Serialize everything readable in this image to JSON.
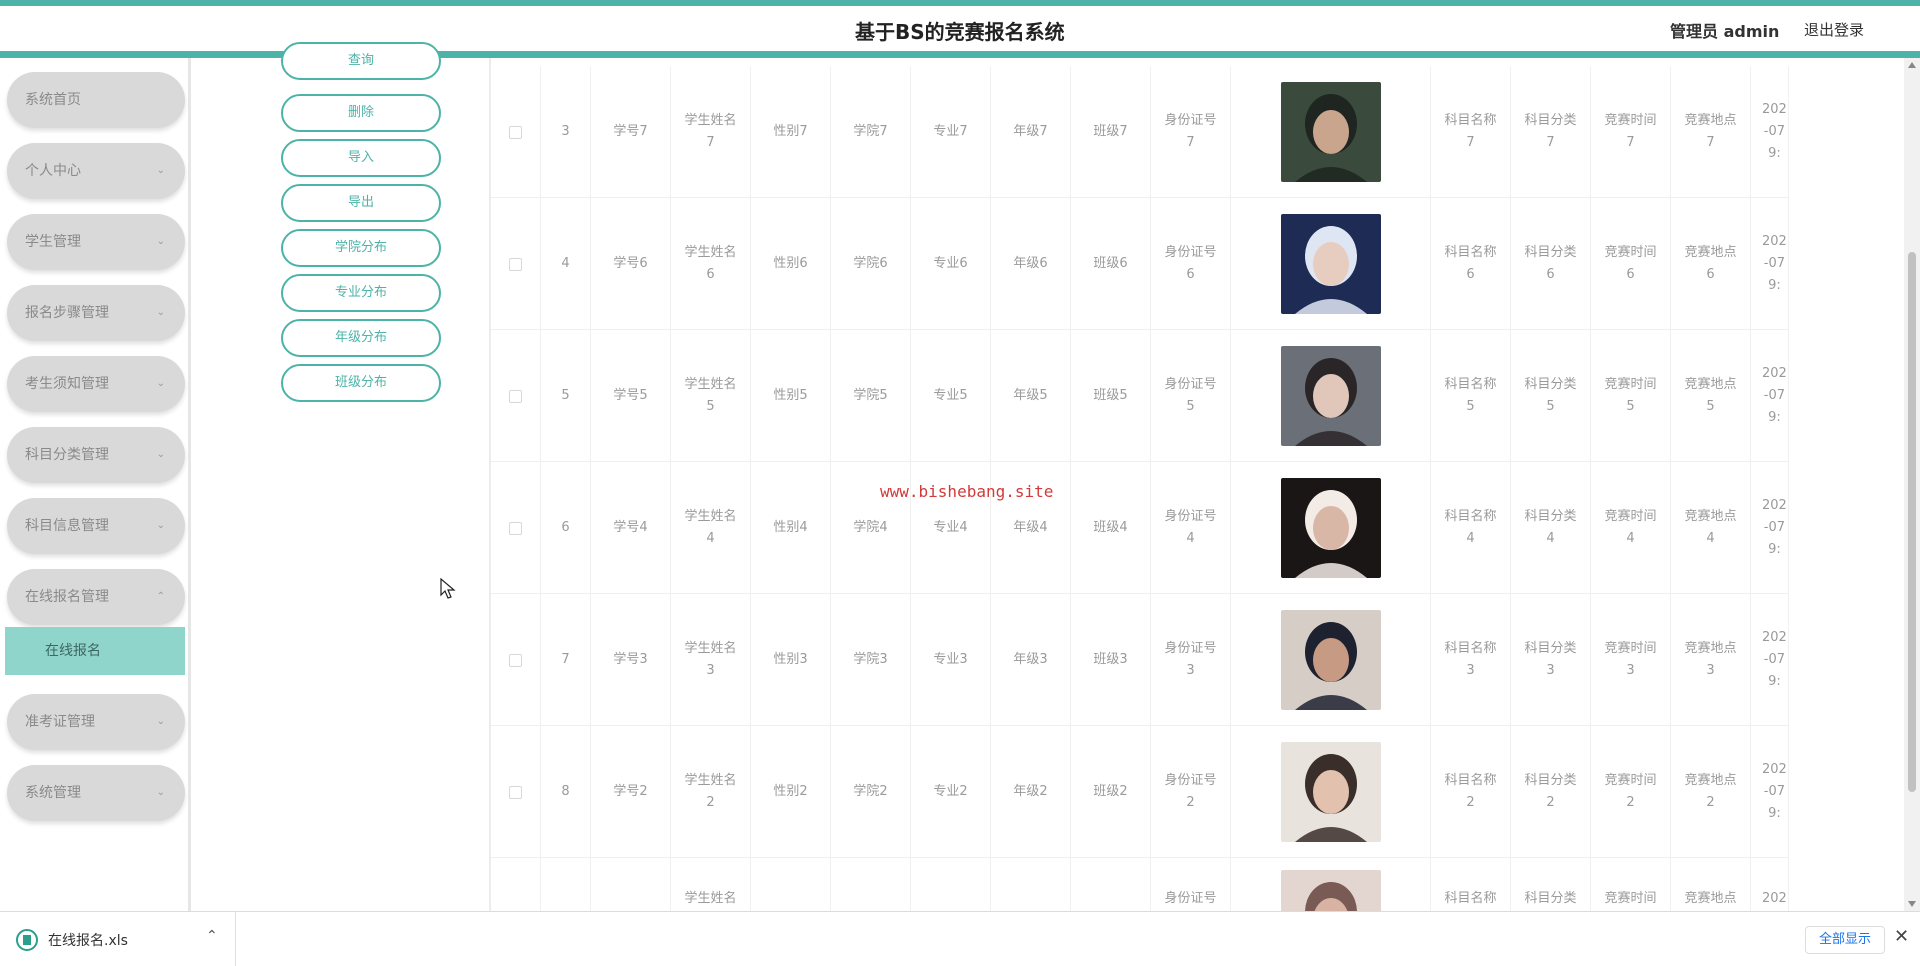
{
  "header": {
    "title": "基于BS的竞赛报名系统",
    "user_label": "管理员 admin",
    "logout_label": "退出登录"
  },
  "sidebar": {
    "items": [
      {
        "label": "系统首页"
      },
      {
        "label": "个人中心"
      },
      {
        "label": "学生管理"
      },
      {
        "label": "报名步骤管理"
      },
      {
        "label": "考生须知管理"
      },
      {
        "label": "科目分类管理"
      },
      {
        "label": "科目信息管理"
      },
      {
        "label": "在线报名管理"
      },
      {
        "label": "准考证管理"
      },
      {
        "label": "系统管理"
      }
    ],
    "active_sub": {
      "label": "在线报名"
    }
  },
  "actions": {
    "query": "查询",
    "delete": "删除",
    "import": "导入",
    "export": "导出",
    "college_dist": "学院分布",
    "major_dist": "专业分布",
    "grade_dist": "年级分布",
    "class_dist": "班级分布"
  },
  "table": {
    "rows": [
      {
        "idx": "3",
        "sid": "学号7",
        "name": "学生姓名\n7",
        "gender": "性别7",
        "college": "学院7",
        "major": "专业7",
        "grade": "年级7",
        "clazz": "班级7",
        "idcard": "身份证号\n7",
        "subject": "科目名称\n7",
        "category": "科目分类\n7",
        "time": "竞赛时间\n7",
        "place": "竞赛地点\n7",
        "date": "202\n-07\n9:",
        "photo_colors": [
          "#3a4a3c",
          "#1f2520",
          "#c9a58e"
        ]
      },
      {
        "idx": "4",
        "sid": "学号6",
        "name": "学生姓名\n6",
        "gender": "性别6",
        "college": "学院6",
        "major": "专业6",
        "grade": "年级6",
        "clazz": "班级6",
        "idcard": "身份证号\n6",
        "subject": "科目名称\n6",
        "category": "科目分类\n6",
        "time": "竞赛时间\n6",
        "place": "竞赛地点\n6",
        "date": "202\n-07\n9:",
        "photo_colors": [
          "#1d2b55",
          "#dfe6f3",
          "#e7cdbf"
        ]
      },
      {
        "idx": "5",
        "sid": "学号5",
        "name": "学生姓名\n5",
        "gender": "性别5",
        "college": "学院5",
        "major": "专业5",
        "grade": "年级5",
        "clazz": "班级5",
        "idcard": "身份证号\n5",
        "subject": "科目名称\n5",
        "category": "科目分类\n5",
        "time": "竞赛时间\n5",
        "place": "竞赛地点\n5",
        "date": "202\n-07\n9:",
        "photo_colors": [
          "#6b6f78",
          "#2a2628",
          "#e1c7ba"
        ]
      },
      {
        "idx": "6",
        "sid": "学号4",
        "name": "学生姓名\n4",
        "gender": "性别4",
        "college": "学院4",
        "major": "专业4",
        "grade": "年级4",
        "clazz": "班级4",
        "idcard": "身份证号\n4",
        "subject": "科目名称\n4",
        "category": "科目分类\n4",
        "time": "竞赛时间\n4",
        "place": "竞赛地点\n4",
        "date": "202\n-07\n9:",
        "photo_colors": [
          "#1b1616",
          "#f2ebe6",
          "#d9b7a6"
        ]
      },
      {
        "idx": "7",
        "sid": "学号3",
        "name": "学生姓名\n3",
        "gender": "性别3",
        "college": "学院3",
        "major": "专业3",
        "grade": "年级3",
        "clazz": "班级3",
        "idcard": "身份证号\n3",
        "subject": "科目名称\n3",
        "category": "科目分类\n3",
        "time": "竞赛时间\n3",
        "place": "竞赛地点\n3",
        "date": "202\n-07\n9:",
        "photo_colors": [
          "#d7cdc7",
          "#1e2230",
          "#c79a83"
        ]
      },
      {
        "idx": "8",
        "sid": "学号2",
        "name": "学生姓名\n2",
        "gender": "性别2",
        "college": "学院2",
        "major": "专业2",
        "grade": "年级2",
        "clazz": "班级2",
        "idcard": "身份证号\n2",
        "subject": "科目名称\n2",
        "category": "科目分类\n2",
        "time": "竞赛时间\n2",
        "place": "竞赛地点\n2",
        "date": "202\n-07\n9:",
        "photo_colors": [
          "#e9e3de",
          "#3a2e2a",
          "#e2c1ae"
        ]
      },
      {
        "idx": "",
        "sid": "",
        "name": "学生姓名",
        "gender": "",
        "college": "",
        "major": "",
        "grade": "",
        "clazz": "",
        "idcard": "身份证号",
        "subject": "科目名称",
        "category": "科目分类",
        "time": "竞赛时间",
        "place": "竞赛地点",
        "date": "202",
        "photo_colors": [
          "#e3d6d0",
          "#7a5a55",
          "#d8b2a2"
        ]
      }
    ]
  },
  "watermark": "www.bishebang.site",
  "downloads": {
    "file_name": "在线报名.xls",
    "show_all": "全部显示"
  },
  "colors": {
    "accent": "#4db3a8",
    "active_submenu": "#8fd5cc",
    "watermark": "#d23a3a"
  }
}
